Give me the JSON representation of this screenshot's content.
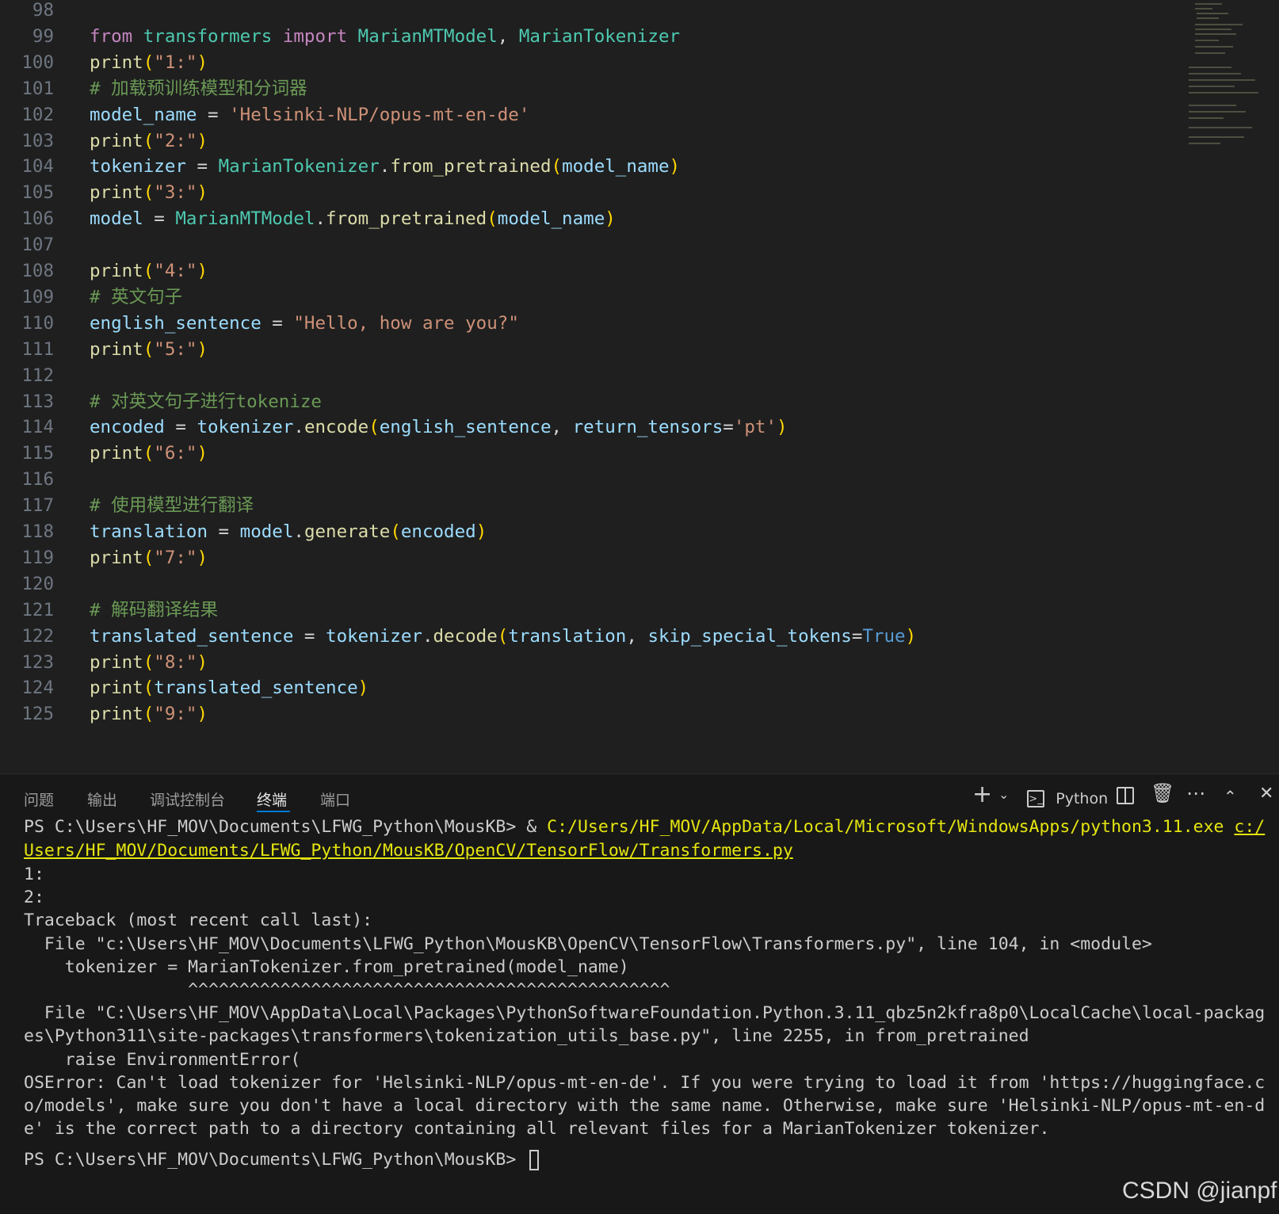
{
  "editor": {
    "lines": [
      {
        "n": "98",
        "tokens": []
      },
      {
        "n": "99",
        "tokens": [
          [
            "kw",
            "from"
          ],
          [
            "op",
            " "
          ],
          [
            "cls",
            "transformers"
          ],
          [
            "op",
            " "
          ],
          [
            "kw",
            "import"
          ],
          [
            "op",
            " "
          ],
          [
            "cls",
            "MarianMTModel"
          ],
          [
            "op",
            ", "
          ],
          [
            "cls",
            "MarianTokenizer"
          ]
        ]
      },
      {
        "n": "100",
        "tokens": [
          [
            "fn",
            "print"
          ],
          [
            "p1",
            "("
          ],
          [
            "str",
            "\"1:\""
          ],
          [
            "p1",
            ")"
          ]
        ]
      },
      {
        "n": "101",
        "tokens": [
          [
            "com",
            "# 加载预训练模型和分词器"
          ]
        ]
      },
      {
        "n": "102",
        "tokens": [
          [
            "var",
            "model_name"
          ],
          [
            "op",
            " = "
          ],
          [
            "str",
            "'Helsinki-NLP/opus-mt-en-de'"
          ]
        ]
      },
      {
        "n": "103",
        "tokens": [
          [
            "fn",
            "print"
          ],
          [
            "p1",
            "("
          ],
          [
            "str",
            "\"2:\""
          ],
          [
            "p1",
            ")"
          ]
        ]
      },
      {
        "n": "104",
        "tokens": [
          [
            "var",
            "tokenizer"
          ],
          [
            "op",
            " = "
          ],
          [
            "cls",
            "MarianTokenizer"
          ],
          [
            "op",
            "."
          ],
          [
            "fn",
            "from_pretrained"
          ],
          [
            "p1",
            "("
          ],
          [
            "var",
            "model_name"
          ],
          [
            "p1",
            ")"
          ]
        ]
      },
      {
        "n": "105",
        "tokens": [
          [
            "fn",
            "print"
          ],
          [
            "p1",
            "("
          ],
          [
            "str",
            "\"3:\""
          ],
          [
            "p1",
            ")"
          ]
        ]
      },
      {
        "n": "106",
        "tokens": [
          [
            "var",
            "model"
          ],
          [
            "op",
            " = "
          ],
          [
            "cls",
            "MarianMTModel"
          ],
          [
            "op",
            "."
          ],
          [
            "fn",
            "from_pretrained"
          ],
          [
            "p1",
            "("
          ],
          [
            "var",
            "model_name"
          ],
          [
            "p1",
            ")"
          ]
        ]
      },
      {
        "n": "107",
        "tokens": []
      },
      {
        "n": "108",
        "tokens": [
          [
            "fn",
            "print"
          ],
          [
            "p1",
            "("
          ],
          [
            "str",
            "\"4:\""
          ],
          [
            "p1",
            ")"
          ]
        ]
      },
      {
        "n": "109",
        "tokens": [
          [
            "com",
            "# 英文句子"
          ]
        ]
      },
      {
        "n": "110",
        "tokens": [
          [
            "var",
            "english_sentence"
          ],
          [
            "op",
            " = "
          ],
          [
            "str",
            "\"Hello, how are you?\""
          ]
        ]
      },
      {
        "n": "111",
        "tokens": [
          [
            "fn",
            "print"
          ],
          [
            "p1",
            "("
          ],
          [
            "str",
            "\"5:\""
          ],
          [
            "p1",
            ")"
          ]
        ]
      },
      {
        "n": "112",
        "tokens": []
      },
      {
        "n": "113",
        "tokens": [
          [
            "com",
            "# 对英文句子进行tokenize"
          ]
        ]
      },
      {
        "n": "114",
        "tokens": [
          [
            "var",
            "encoded"
          ],
          [
            "op",
            " = "
          ],
          [
            "var",
            "tokenizer"
          ],
          [
            "op",
            "."
          ],
          [
            "fn",
            "encode"
          ],
          [
            "p1",
            "("
          ],
          [
            "var",
            "english_sentence"
          ],
          [
            "op",
            ", "
          ],
          [
            "var",
            "return_tensors"
          ],
          [
            "op",
            "="
          ],
          [
            "str",
            "'pt'"
          ],
          [
            "p1",
            ")"
          ]
        ]
      },
      {
        "n": "115",
        "tokens": [
          [
            "fn",
            "print"
          ],
          [
            "p1",
            "("
          ],
          [
            "str",
            "\"6:\""
          ],
          [
            "p1",
            ")"
          ]
        ]
      },
      {
        "n": "116",
        "tokens": []
      },
      {
        "n": "117",
        "tokens": [
          [
            "com",
            "# 使用模型进行翻译"
          ]
        ]
      },
      {
        "n": "118",
        "tokens": [
          [
            "var",
            "translation"
          ],
          [
            "op",
            " = "
          ],
          [
            "var",
            "model"
          ],
          [
            "op",
            "."
          ],
          [
            "fn",
            "generate"
          ],
          [
            "p1",
            "("
          ],
          [
            "var",
            "encoded"
          ],
          [
            "p1",
            ")"
          ]
        ]
      },
      {
        "n": "119",
        "tokens": [
          [
            "fn",
            "print"
          ],
          [
            "p1",
            "("
          ],
          [
            "str",
            "\"7:\""
          ],
          [
            "p1",
            ")"
          ]
        ]
      },
      {
        "n": "120",
        "tokens": []
      },
      {
        "n": "121",
        "tokens": [
          [
            "com",
            "# 解码翻译结果"
          ]
        ]
      },
      {
        "n": "122",
        "tokens": [
          [
            "var",
            "translated_sentence"
          ],
          [
            "op",
            " = "
          ],
          [
            "var",
            "tokenizer"
          ],
          [
            "op",
            "."
          ],
          [
            "fn",
            "decode"
          ],
          [
            "p1",
            "("
          ],
          [
            "var",
            "translation"
          ],
          [
            "op",
            ", "
          ],
          [
            "var",
            "skip_special_tokens"
          ],
          [
            "op",
            "="
          ],
          [
            "bool",
            "True"
          ],
          [
            "p1",
            ")"
          ]
        ]
      },
      {
        "n": "123",
        "tokens": [
          [
            "fn",
            "print"
          ],
          [
            "p1",
            "("
          ],
          [
            "str",
            "\"8:\""
          ],
          [
            "p1",
            ")"
          ]
        ]
      },
      {
        "n": "124",
        "tokens": [
          [
            "fn",
            "print"
          ],
          [
            "p1",
            "("
          ],
          [
            "var",
            "translated_sentence"
          ],
          [
            "p1",
            ")"
          ]
        ]
      },
      {
        "n": "125",
        "tokens": [
          [
            "fn",
            "print"
          ],
          [
            "p1",
            "("
          ],
          [
            "str",
            "\"9:\""
          ],
          [
            "p1",
            ")"
          ]
        ]
      }
    ]
  },
  "panel": {
    "tabs": [
      "问题",
      "输出",
      "调试控制台",
      "终端",
      "端口"
    ],
    "active_tab": "终端",
    "toolbar": {
      "add_icon": "plus-icon",
      "dropdown_icon": "chevron-down-icon",
      "shell_icon": "terminal-icon",
      "shell_label": "Python",
      "split_icon": "split-icon",
      "trash_icon": "trash-icon",
      "more_icon": "ellipsis-icon",
      "maximize_icon": "chevron-up-icon",
      "close_icon": "close-icon"
    }
  },
  "terminal": {
    "cmd_prompt": "PS C:\\Users\\HF_MOV\\Documents\\LFWG_Python\\MousKB> ",
    "cmd_amp": "& ",
    "cmd_exe": "C:/Users/HF_MOV/AppData/Local/Microsoft/WindowsApps/python3.11.exe",
    "cmd_script_part1": "c:/",
    "cmd_script_part2": "Users/HF_MOV/Documents/LFWG_Python/MousKB/OpenCV/TensorFlow/Transformers.py",
    "output": [
      "1:",
      "2:",
      "Traceback (most recent call last):",
      "  File \"c:\\Users\\HF_MOV\\Documents\\LFWG_Python\\MousKB\\OpenCV\\TensorFlow\\Transformers.py\", line 104, in <module>",
      "    tokenizer = MarianTokenizer.from_pretrained(model_name)",
      "                ^^^^^^^^^^^^^^^^^^^^^^^^^^^^^^^^^^^^^^^^^^^^^^^",
      "  File \"C:\\Users\\HF_MOV\\AppData\\Local\\Packages\\PythonSoftwareFoundation.Python.3.11_qbz5n2kfra8p0\\LocalCache\\local-packag",
      "es\\Python311\\site-packages\\transformers\\tokenization_utils_base.py\", line 2255, in from_pretrained",
      "    raise EnvironmentError(",
      "OSError: Can't load tokenizer for 'Helsinki-NLP/opus-mt-en-de'. If you were trying to load it from 'https://huggingface.c",
      "o/models', make sure you don't have a local directory with the same name. Otherwise, make sure 'Helsinki-NLP/opus-mt-en-d",
      "e' is the correct path to a directory containing all relevant files for a MarianTokenizer tokenizer."
    ],
    "final_prompt": "PS C:\\Users\\HF_MOV\\Documents\\LFWG_Python\\MousKB> "
  },
  "watermark": "CSDN @jianpf"
}
